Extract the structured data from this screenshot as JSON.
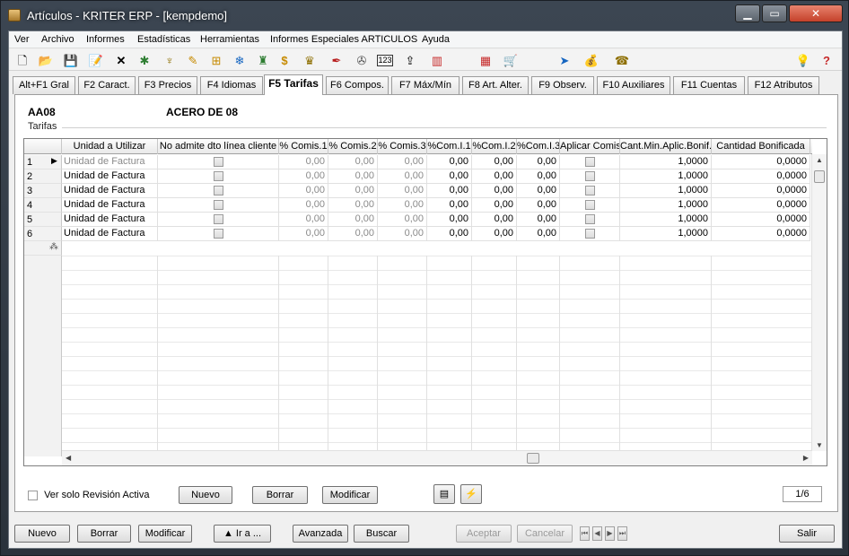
{
  "window": {
    "title": "Artículos - KRITER ERP - [kempdemo]"
  },
  "menu": [
    "Ver",
    "Archivo",
    "Informes",
    "Estadísticas",
    "Herramientas",
    "Informes Especiales ARTICULOS",
    "Ayuda"
  ],
  "toolbar_icons": [
    "new-icon",
    "open-folder-icon",
    "save-icon",
    "edit-icon",
    "delete-icon",
    "tool1-icon",
    "tool2-icon",
    "tool3-icon",
    "tool4-icon",
    "tool5-icon",
    "tool6-icon",
    "money-icon",
    "stamp-icon",
    "tool7-icon",
    "tool8-icon",
    "numeric-123-icon",
    "upload-icon",
    "bar-chart-icon",
    "calculator-icon",
    "cart-icon",
    "tool9-icon",
    "money-bag-icon",
    "tool10-icon",
    "lightbulb-icon",
    "help-icon"
  ],
  "tabs": [
    "Alt+F1 Gral",
    "F2 Caract.",
    "F3 Precios",
    "F4 Idiomas",
    "F5 Tarifas",
    "F6 Compos.",
    "F7 Máx/Mín",
    "F8 Art. Alter.",
    "F9 Observ.",
    "F10 Auxiliares",
    "F11 Cuentas",
    "F12 Atributos"
  ],
  "active_tab": 4,
  "article": {
    "code": "AA08",
    "description": "ACERO DE 08"
  },
  "section_label": "Tarifas",
  "grid": {
    "columns": [
      "Unidad a Utilizar",
      "No admite dto línea cliente",
      "% Comis.1",
      "% Comis.2",
      "% Comis.3",
      "%Com.I.1",
      "%Com.I.2",
      "%Com.I.3",
      "Aplicar Comis.",
      "Cant.Min.Aplic.Bonif.",
      "Cantidad Bonificada"
    ],
    "rows": [
      {
        "n": "1",
        "unidad": "Unidad de Factura",
        "c1": "0,00",
        "c2": "0,00",
        "c3": "0,00",
        "ci1": "0,00",
        "ci2": "0,00",
        "ci3": "0,00",
        "cant": "1,0000",
        "bonif": "0,0000"
      },
      {
        "n": "2",
        "unidad": "Unidad de Factura",
        "c1": "0,00",
        "c2": "0,00",
        "c3": "0,00",
        "ci1": "0,00",
        "ci2": "0,00",
        "ci3": "0,00",
        "cant": "1,0000",
        "bonif": "0,0000"
      },
      {
        "n": "3",
        "unidad": "Unidad de Factura",
        "c1": "0,00",
        "c2": "0,00",
        "c3": "0,00",
        "ci1": "0,00",
        "ci2": "0,00",
        "ci3": "0,00",
        "cant": "1,0000",
        "bonif": "0,0000"
      },
      {
        "n": "4",
        "unidad": "Unidad de Factura",
        "c1": "0,00",
        "c2": "0,00",
        "c3": "0,00",
        "ci1": "0,00",
        "ci2": "0,00",
        "ci3": "0,00",
        "cant": "1,0000",
        "bonif": "0,0000"
      },
      {
        "n": "5",
        "unidad": "Unidad de Factura",
        "c1": "0,00",
        "c2": "0,00",
        "c3": "0,00",
        "ci1": "0,00",
        "ci2": "0,00",
        "ci3": "0,00",
        "cant": "1,0000",
        "bonif": "0,0000"
      },
      {
        "n": "6",
        "unidad": "Unidad de Factura",
        "c1": "0,00",
        "c2": "0,00",
        "c3": "0,00",
        "ci1": "0,00",
        "ci2": "0,00",
        "ci3": "0,00",
        "cant": "1,0000",
        "bonif": "0,0000"
      }
    ],
    "new_row_marker": "⁂"
  },
  "panel": {
    "checkbox_label": "Ver solo Revisión Activa",
    "nuevo": "Nuevo",
    "borrar": "Borrar",
    "modificar": "Modificar",
    "pager": "1/6"
  },
  "bottom": {
    "nuevo": "Nuevo",
    "borrar": "Borrar",
    "modificar": "Modificar",
    "ira": "Ir a ...",
    "avanzada": "Avanzada",
    "buscar": "Buscar",
    "aceptar": "Aceptar",
    "cancelar": "Cancelar",
    "salir": "Salir"
  }
}
